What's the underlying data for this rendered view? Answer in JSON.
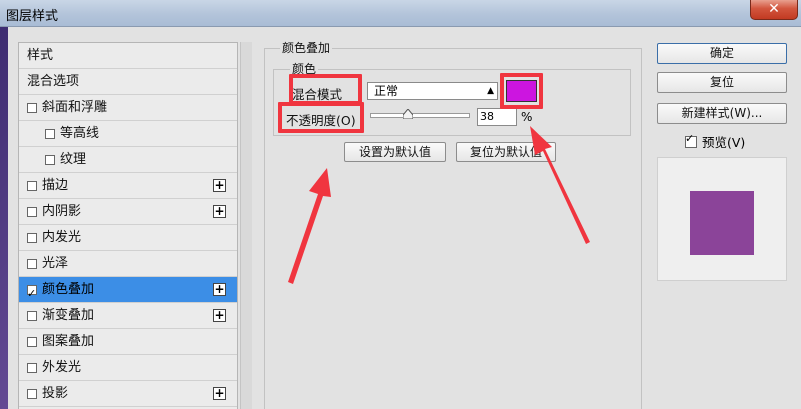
{
  "window": {
    "title": "图层样式",
    "close_symbol": "✕"
  },
  "style_list": {
    "items": [
      {
        "label": "样式",
        "has_checkbox": false,
        "checked": false,
        "has_plus": false
      },
      {
        "label": "混合选项",
        "has_checkbox": false,
        "checked": false,
        "has_plus": false
      },
      {
        "label": "斜面和浮雕",
        "has_checkbox": true,
        "checked": false,
        "has_plus": false
      },
      {
        "label": "等高线",
        "has_checkbox": true,
        "checked": false,
        "has_plus": false
      },
      {
        "label": "纹理",
        "has_checkbox": true,
        "checked": false,
        "has_plus": false
      },
      {
        "label": "描边",
        "has_checkbox": true,
        "checked": false,
        "has_plus": true
      },
      {
        "label": "内阴影",
        "has_checkbox": true,
        "checked": false,
        "has_plus": true
      },
      {
        "label": "内发光",
        "has_checkbox": true,
        "checked": false,
        "has_plus": false
      },
      {
        "label": "光泽",
        "has_checkbox": true,
        "checked": false,
        "has_plus": false
      },
      {
        "label": "颜色叠加",
        "has_checkbox": true,
        "checked": true,
        "has_plus": true
      },
      {
        "label": "渐变叠加",
        "has_checkbox": true,
        "checked": false,
        "has_plus": true
      },
      {
        "label": "图案叠加",
        "has_checkbox": true,
        "checked": false,
        "has_plus": false
      },
      {
        "label": "外发光",
        "has_checkbox": true,
        "checked": false,
        "has_plus": false
      },
      {
        "label": "投影",
        "has_checkbox": true,
        "checked": false,
        "has_plus": true
      }
    ],
    "selected_label": "颜色叠加",
    "plus_symbol": "+"
  },
  "color_overlay": {
    "group_title": "颜色叠加",
    "sub_group_title": "颜色",
    "blend_mode_label": "混合模式",
    "blend_mode_value": "正常",
    "overlay_color": "#cc15e0",
    "opacity_label": "不透明度(O)",
    "opacity_value": "38",
    "opacity_fraction": 0.38,
    "opacity_unit": "%",
    "set_default_label": "设置为默认值",
    "reset_default_label": "复位为默认值"
  },
  "actions": {
    "ok_label": "确定",
    "reset_label": "复位",
    "new_style_label": "新建样式(W)...",
    "preview_label": "预览(V)",
    "preview_checked": true,
    "preview_color": "#8b4499"
  },
  "colors": {
    "selection": "#3c8ee6",
    "annotation": "#f0353f"
  }
}
